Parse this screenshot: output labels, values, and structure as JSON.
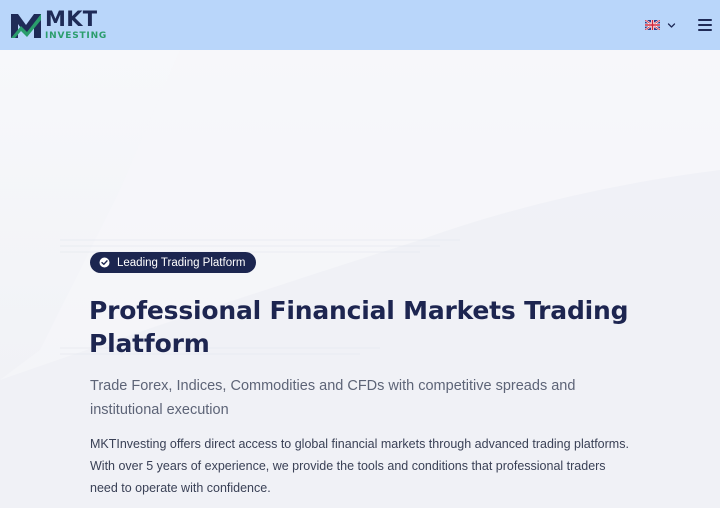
{
  "header": {
    "logo": {
      "main": "MKT",
      "sub": "INVESTING"
    },
    "language": {
      "flag_icon": "uk-flag-icon",
      "chevron_icon": "chevron-down-icon"
    },
    "menu_icon": "hamburger-menu-icon"
  },
  "hero": {
    "badge_label": "Leading Trading Platform",
    "badge_icon": "check-circle-icon",
    "title": "Professional Financial Markets Trading Platform",
    "subtitle": "Trade Forex, Indices, Commodities and CFDs with competitive spreads and institutional execution",
    "description": "MKTInvesting offers direct access to global financial markets through advanced trading platforms. With over 5 years of experience, we provide the tools and conditions that professional traders need to operate with confidence."
  },
  "colors": {
    "header_bg": "#b9d6fa",
    "brand_navy": "#1f2b57",
    "brand_green": "#2a9d6c",
    "badge_bg": "#1c2650"
  }
}
